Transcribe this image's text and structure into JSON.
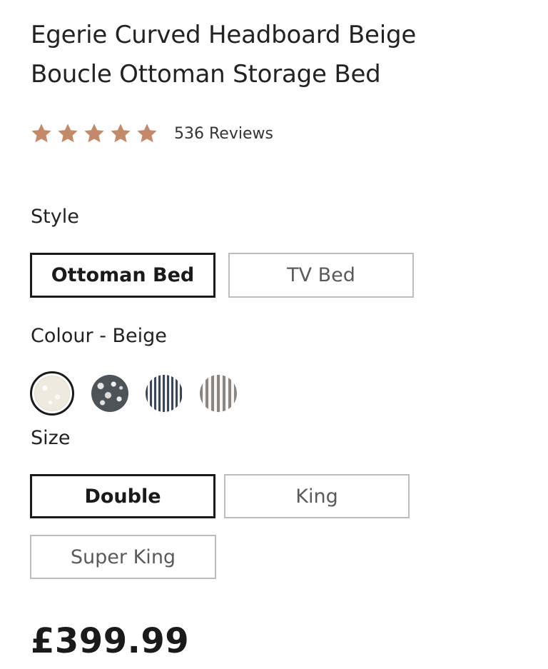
{
  "product": {
    "title_line1": "Egerie Curved Headboard Beige",
    "title_line2": "Boucle Ottoman Storage Bed",
    "rating": 5,
    "rating_max": 5,
    "review_count_text": "536 Reviews",
    "price": "£399.99"
  },
  "colors": {
    "star": "#c28a6a",
    "selected_border": "#1a1a1a",
    "unselected_border": "#bdbdbd"
  },
  "style": {
    "label": "Style",
    "options": [
      {
        "label": "Ottoman Bed",
        "selected": true
      },
      {
        "label": "TV Bed",
        "selected": false
      }
    ]
  },
  "colour": {
    "label": "Colour - Beige",
    "swatches": [
      {
        "name": "beige-boucle",
        "selected": true
      },
      {
        "name": "grey-boucle",
        "selected": false
      },
      {
        "name": "navy-stripe",
        "selected": false
      },
      {
        "name": "grey-stripe",
        "selected": false
      }
    ]
  },
  "size": {
    "label": "Size",
    "options": [
      {
        "label": "Double",
        "selected": true
      },
      {
        "label": "King",
        "selected": false
      },
      {
        "label": "Super King",
        "selected": false
      }
    ]
  },
  "icons": {
    "star": "star-icon"
  }
}
